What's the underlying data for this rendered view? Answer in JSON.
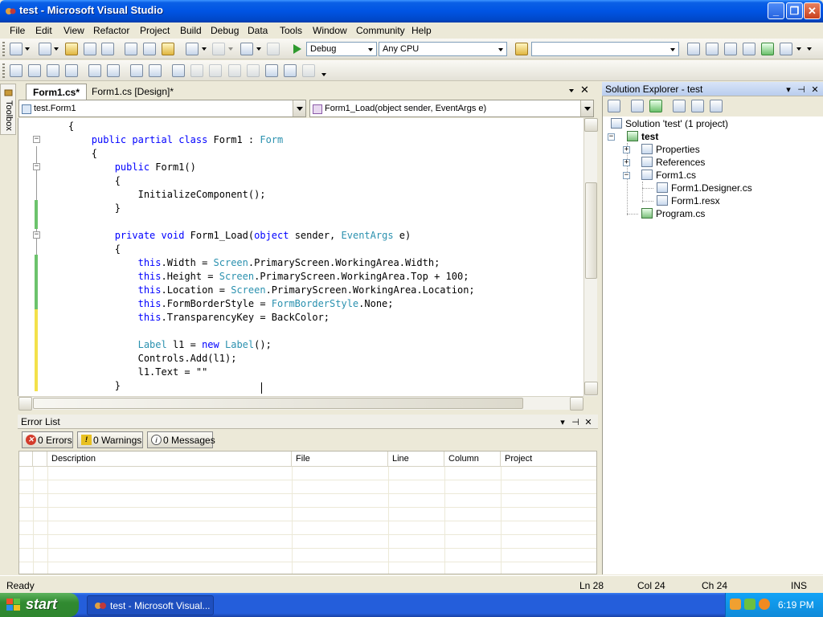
{
  "window": {
    "title": "test - Microsoft Visual Studio",
    "minimize": "_",
    "maximize": "❐",
    "close": "✕"
  },
  "menu": [
    "File",
    "Edit",
    "View",
    "Refactor",
    "Project",
    "Build",
    "Debug",
    "Data",
    "Tools",
    "Window",
    "Community",
    "Help"
  ],
  "toolbar": {
    "config": "Debug",
    "platform": "Any CPU"
  },
  "toolbox_label": "Toolbox",
  "tabs": [
    {
      "label": "Form1.cs*",
      "active": true
    },
    {
      "label": "Form1.cs [Design]*",
      "active": false
    }
  ],
  "nav": {
    "class_combo": "test.Form1",
    "member_combo": "Form1_Load(object sender, EventArgs e)"
  },
  "code": [
    "    {",
    "        public partial class Form1 : Form",
    "        {",
    "            public Form1()",
    "            {",
    "                InitializeComponent();",
    "            }",
    "",
    "            private void Form1_Load(object sender, EventArgs e)",
    "            {",
    "                this.Width = Screen.PrimaryScreen.WorkingArea.Width;",
    "                this.Height = Screen.PrimaryScreen.WorkingArea.Top + 100;",
    "                this.Location = Screen.PrimaryScreen.WorkingArea.Location;",
    "                this.FormBorderStyle = FormBorderStyle.None;",
    "                this.TransparencyKey = BackColor;",
    "",
    "                Label l1 = new Label();",
    "                Controls.Add(l1);",
    "                l1.Text = \"\"",
    "            }"
  ],
  "error_list": {
    "title": "Error List",
    "errors": "0 Errors",
    "warnings": "0 Warnings",
    "messages": "0 Messages",
    "columns": [
      "Description",
      "File",
      "Line",
      "Column",
      "Project"
    ]
  },
  "solution_explorer": {
    "title": "Solution Explorer - test",
    "items": [
      {
        "label": "Solution 'test' (1 project)",
        "bold": false
      },
      {
        "label": "test",
        "bold": true
      },
      {
        "label": "Properties",
        "bold": false
      },
      {
        "label": "References",
        "bold": false
      },
      {
        "label": "Form1.cs",
        "bold": false
      },
      {
        "label": "Form1.Designer.cs",
        "bold": false
      },
      {
        "label": "Form1.resx",
        "bold": false
      },
      {
        "label": "Program.cs",
        "bold": false
      }
    ]
  },
  "status": {
    "ready": "Ready",
    "ln": "Ln 28",
    "col": "Col 24",
    "ch": "Ch 24",
    "ins": "INS"
  },
  "taskbar": {
    "start": "start",
    "item": "test - Microsoft Visual...",
    "clock": "6:19 PM"
  },
  "colors": {
    "keyword": "#0000ff",
    "type": "#2b91af",
    "title_bar": "#0054e3",
    "start_button": "#318a31"
  }
}
